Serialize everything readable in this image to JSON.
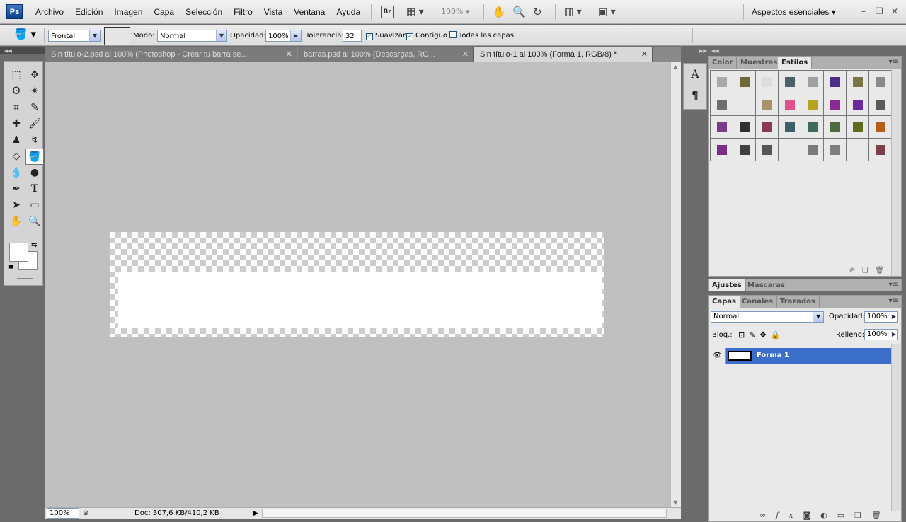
{
  "app": {
    "logo": "Ps",
    "workspace": "Aspectos esenciales",
    "bridge_label": "Br",
    "zoom_menu": "100%"
  },
  "menu": [
    "Archivo",
    "Edición",
    "Imagen",
    "Capa",
    "Selección",
    "Filtro",
    "Vista",
    "Ventana",
    "Ayuda"
  ],
  "options": {
    "fill_source": "Frontal",
    "mode_label": "Modo:",
    "mode_value": "Normal",
    "opacity_label": "Opacidad:",
    "opacity_value": "100%",
    "tolerance_label": "Tolerancia:",
    "tolerance_value": "32",
    "antialias_label": "Suavizar",
    "contiguous_label": "Contiguo",
    "all_layers_label": "Todas las capas"
  },
  "tabs": [
    {
      "label": "Sin título-2.psd al 100% (Photoshop - Crear tu barra se..."
    },
    {
      "label": "barras.psd al 100% (Descargas, RG..."
    },
    {
      "label": "Sin título-1 al 100% (Forma 1, RGB/8) *"
    }
  ],
  "status": {
    "zoom": "100%",
    "doc": "Doc: 307,6 KB/410,2 KB"
  },
  "styles_panel": {
    "tabs": [
      "Color",
      "Muestras",
      "Estilos"
    ],
    "swatches": [
      "#a9a9a9",
      "#6e6a3c",
      "#dedede",
      "#4d5f6b",
      "#a0a0a0",
      "#4b2e86",
      "#7a7545",
      "#8a8a8a",
      "#6e6e6e",
      "",
      "#a8936a",
      "#e0508c",
      "#b5a51e",
      "#8a2a90",
      "#6a2a9e",
      "#5a5a5a",
      "#7a3a8a",
      "#303030",
      "#8a3a55",
      "#3f5e68",
      "#3f6a5a",
      "#4d6a3f",
      "#5e6a1e",
      "#b55e1e",
      "#7e2a8a",
      "#404040",
      "#555555",
      "",
      "#7a7a7a",
      "#7e7e7e",
      "",
      "#7e4048"
    ]
  },
  "adjust_panel": {
    "tabs": [
      "Ajustes",
      "Máscaras"
    ]
  },
  "layers_panel": {
    "tabs": [
      "Capas",
      "Canales",
      "Trazados"
    ],
    "blend_mode": "Normal",
    "opacity_label": "Opacidad:",
    "opacity_value": "100%",
    "lock_label": "Bloq.:",
    "fill_label": "Relleno:",
    "fill_value": "100%",
    "layers": [
      {
        "name": "Forma 1"
      }
    ]
  }
}
